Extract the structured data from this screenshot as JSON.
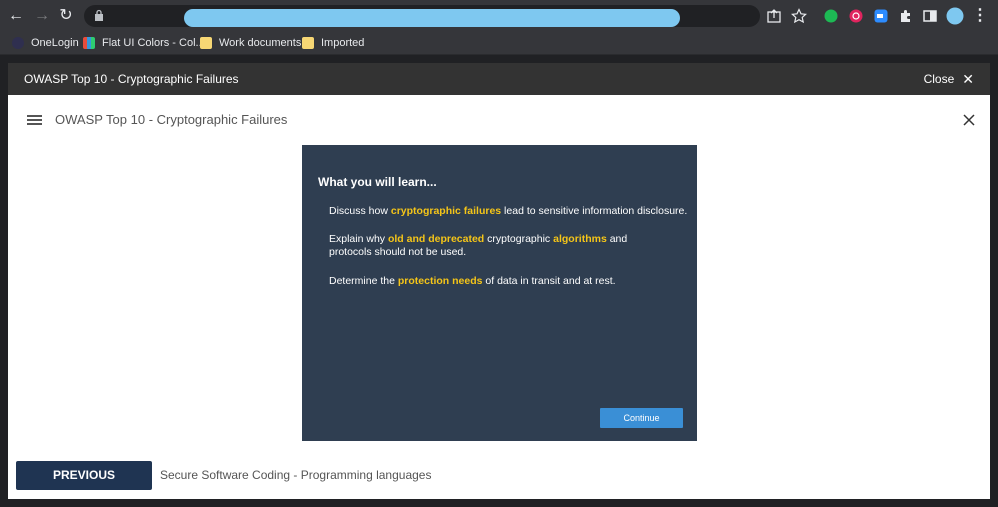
{
  "bookmarks": [
    {
      "label": "OneLogin",
      "icon": "onelogin-icon",
      "color": "#2f2f4f"
    },
    {
      "label": "Flat UI Colors - Col...",
      "icon": "flat-ui-icon",
      "color": "#e74c3c"
    },
    {
      "label": "Work documents",
      "icon": "folder-icon",
      "color": "#f7d774"
    },
    {
      "label": "Imported",
      "icon": "folder-icon",
      "color": "#f7d774"
    }
  ],
  "modal": {
    "title": "OWASP Top 10 - Cryptographic Failures",
    "close_label": "Close"
  },
  "course": {
    "title": "OWASP Top 10 - Cryptographic Failures"
  },
  "card": {
    "heading": "What you will learn...",
    "p1": {
      "a": "Discuss how ",
      "b": "cryptographic failures",
      "c": " lead to sensitive information disclosure."
    },
    "p2": {
      "a": "Explain why ",
      "b": "old and deprecated",
      "c": " cryptographic ",
      "d": "algorithms",
      "e": " and protocols should not be used."
    },
    "p3": {
      "a": "Determine the ",
      "b": "protection needs",
      "c": " of data in transit and at rest."
    },
    "continue_label": "Continue"
  },
  "footer": {
    "previous_label": "PREVIOUS",
    "next_title": "Secure Software Coding - Programming languages"
  },
  "colors": {
    "accent": "#f5c518",
    "card_bg": "#2f3e51",
    "button": "#3a8fd6",
    "previous_bg": "#1f3452"
  }
}
